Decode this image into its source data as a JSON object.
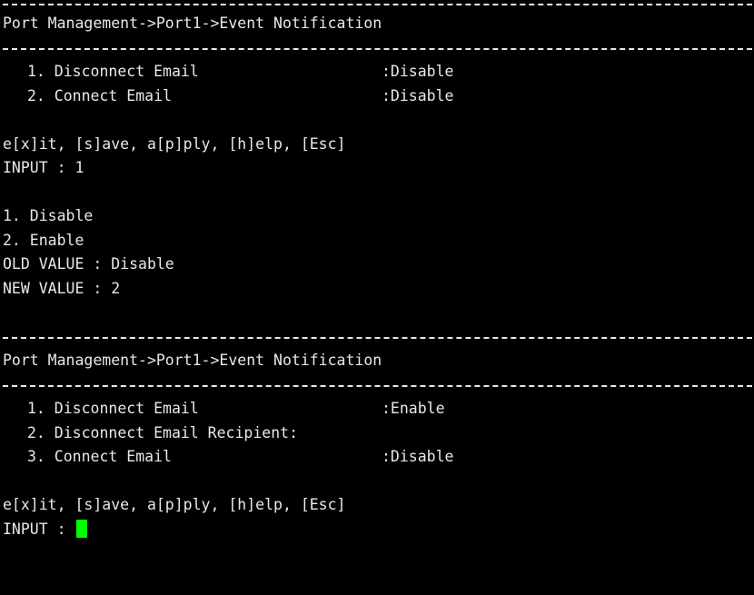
{
  "screen1": {
    "title": "Port Management->Port1->Event Notification",
    "items": [
      {
        "label": "1. Disconnect Email",
        "value": ":Disable"
      },
      {
        "label": "2. Connect Email",
        "value": ":Disable"
      }
    ],
    "commands": "e[x]it, [s]ave, a[p]ply, [h]elp, [Esc]",
    "input": "INPUT : 1"
  },
  "options": {
    "opt1": "1. Disable",
    "opt2": "2. Enable",
    "old_value": "OLD VALUE : Disable",
    "new_value": "NEW VALUE : 2"
  },
  "screen2": {
    "title": "Port Management->Port1->Event Notification",
    "items": [
      {
        "label": "1. Disconnect Email",
        "value": ":Enable"
      },
      {
        "label": "2. Disconnect Email Recipient:",
        "value": ""
      },
      {
        "label": "3. Connect Email",
        "value": ":Disable"
      }
    ],
    "commands": "e[x]it, [s]ave, a[p]ply, [h]elp, [Esc]",
    "input": "INPUT : "
  },
  "colors": {
    "background": "#000000",
    "text": "#e8e8e8",
    "cursor": "#00ff00"
  }
}
